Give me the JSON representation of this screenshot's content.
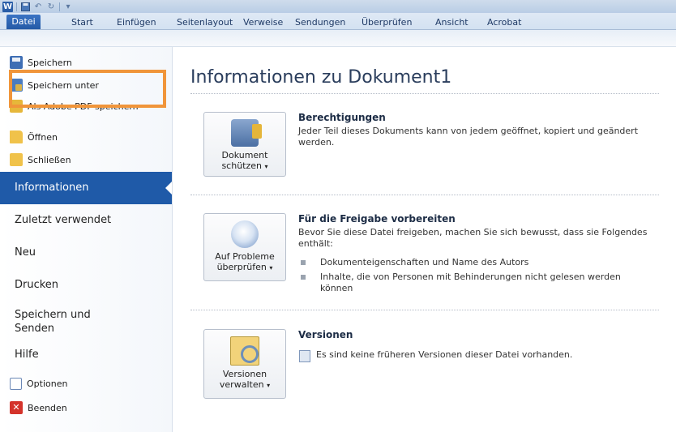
{
  "title_bar": {
    "app_logo": "W",
    "undo_glyph": "↶",
    "redo_glyph": "↻",
    "customize_glyph": "▾"
  },
  "tabs": [
    "Datei",
    "Start",
    "Einfügen",
    "Seitenlayout",
    "Verweise",
    "Sendungen",
    "Überprüfen",
    "Ansicht",
    "Acrobat"
  ],
  "nav": {
    "commands": [
      "Speichern",
      "Speichern unter",
      "Als Adobe PDF speichern",
      "Öffnen",
      "Schließen"
    ],
    "sections": [
      "Informationen",
      "Zuletzt verwendet",
      "Neu",
      "Drucken",
      "Speichern und Senden",
      "Hilfe"
    ],
    "bottom": [
      "Optionen",
      "Beenden"
    ],
    "exit_glyph": "✕",
    "highlight_color": "#f0953a",
    "active_color": "#1f5aa8"
  },
  "main": {
    "heading": "Informationen zu Dokument1",
    "sections": [
      {
        "button_line1": "Dokument",
        "button_line2": "schützen",
        "title": "Berechtigungen",
        "text": "Jeder Teil dieses Dokuments kann von jedem geöffnet, kopiert und geändert werden."
      },
      {
        "button_line1": "Auf Probleme",
        "button_line2": "überprüfen",
        "title": "Für die Freigabe vorbereiten",
        "text": "Bevor Sie diese Datei freigeben, machen Sie sich bewusst, dass sie Folgendes enthält:",
        "bullets": [
          "Dokumenteigenschaften und Name des Autors",
          "Inhalte, die von Personen mit Behinderungen nicht gelesen werden können"
        ]
      },
      {
        "button_line1": "Versionen",
        "button_line2": "verwalten",
        "title": "Versionen",
        "text": "Es sind keine früheren Versionen dieser Datei vorhanden."
      }
    ],
    "caret": "▾"
  }
}
